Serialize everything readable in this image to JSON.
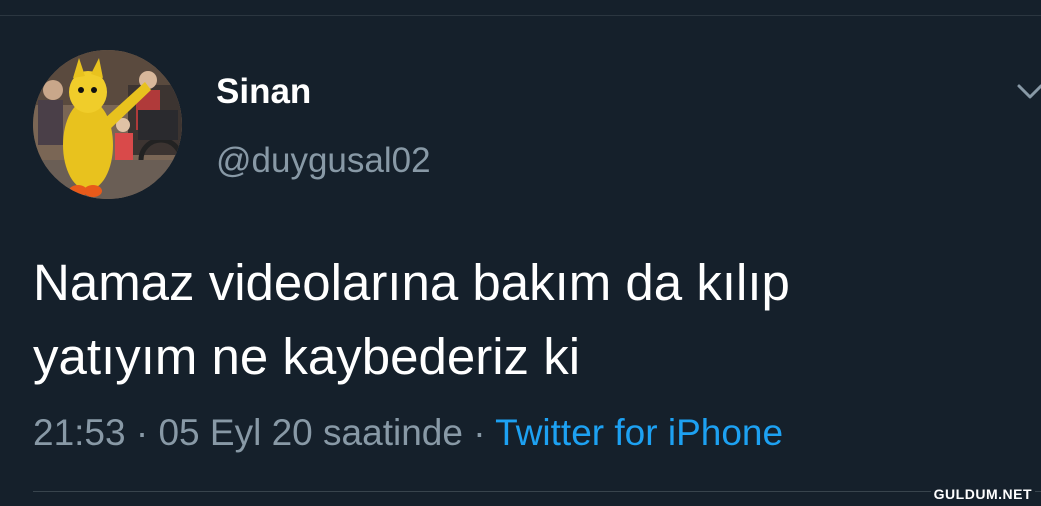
{
  "author": {
    "display_name": "Sinan",
    "handle": "@duygusal02",
    "avatar_icon": "mascot-costume-avatar"
  },
  "tweet": {
    "text_line_1": "Namaz videolarına bakım da kılıp",
    "text_line_2": "yatıyım ne kaybederiz ki"
  },
  "meta": {
    "time": "21:53",
    "separator": "·",
    "date": "05 Eyl 20 saatinde",
    "source": "Twitter for iPhone"
  },
  "menu_icon": "chevron-down-icon",
  "watermark": "GULDUM.NET",
  "colors": {
    "background": "#15202b",
    "text_primary": "#ffffff",
    "text_secondary": "#8899a6",
    "link": "#1da1f2",
    "divider": "#38444d"
  }
}
